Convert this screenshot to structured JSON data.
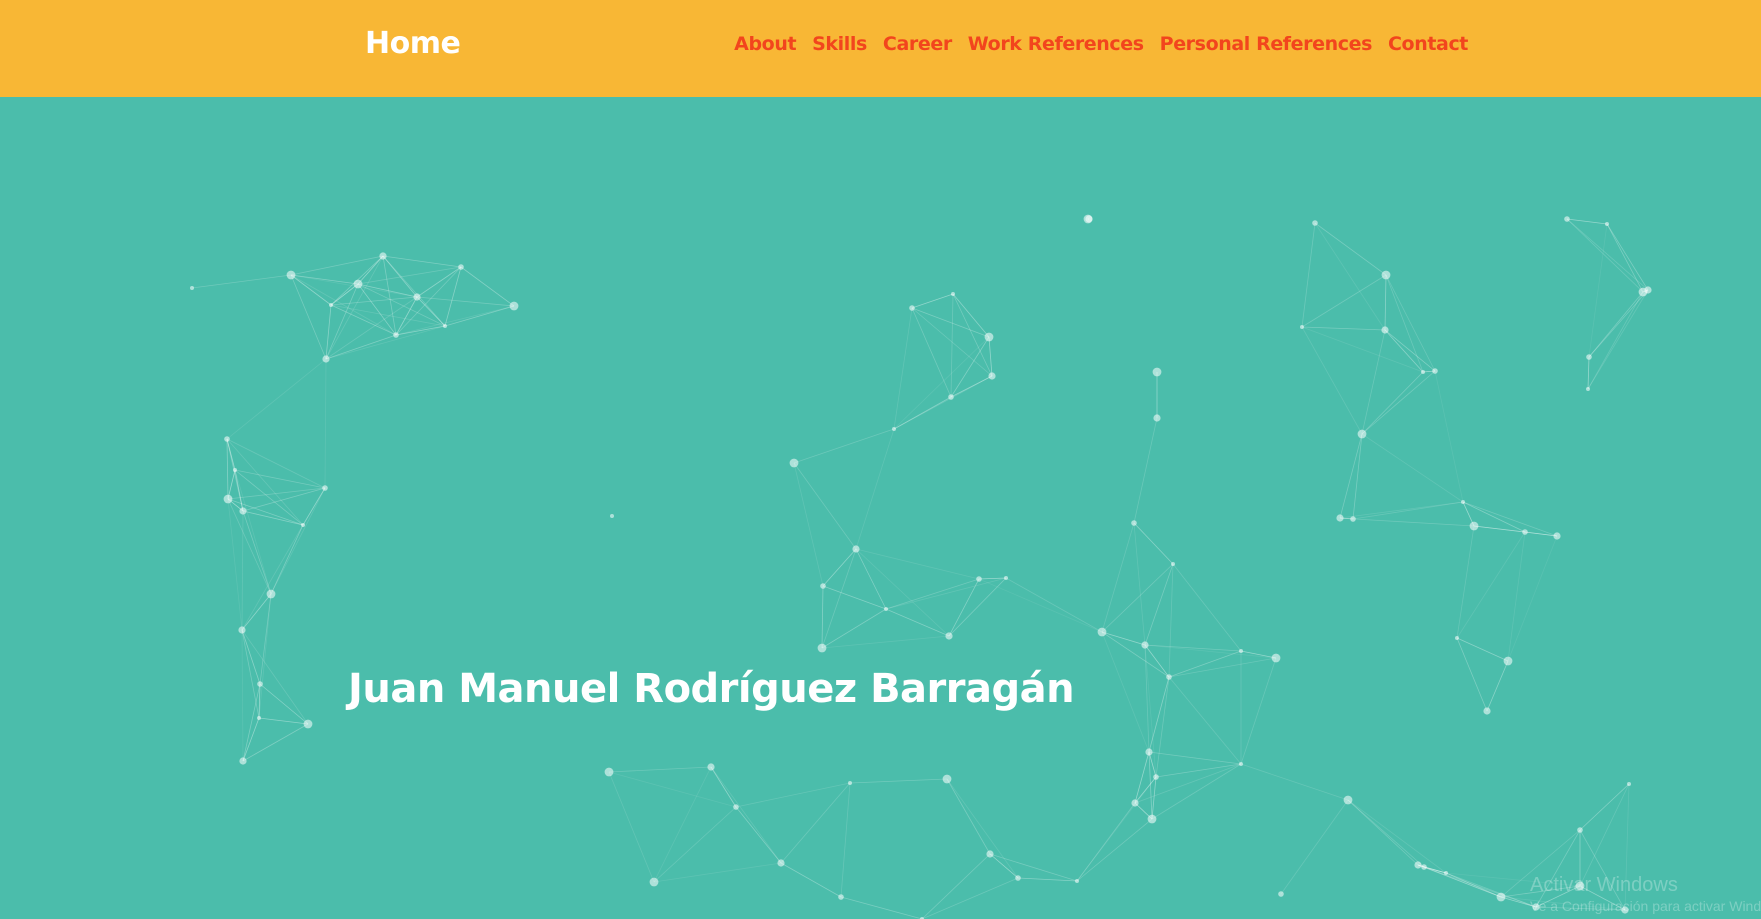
{
  "nav": {
    "brand": "Home",
    "links": [
      {
        "label": "About"
      },
      {
        "label": "Skills"
      },
      {
        "label": "Career"
      },
      {
        "label": "Work References"
      },
      {
        "label": "Personal References"
      },
      {
        "label": "Contact"
      }
    ]
  },
  "hero": {
    "title": "Juan Manuel Rodríguez Barragán"
  },
  "watermark": {
    "title": "Activar Windows",
    "subtitle": "Ve a Configuración para activar Windows."
  },
  "colors": {
    "navbar_bg": "#f8b735",
    "nav_link": "#f2451d",
    "hero_bg": "#4bbdab",
    "brand_text": "#ffffff"
  }
}
